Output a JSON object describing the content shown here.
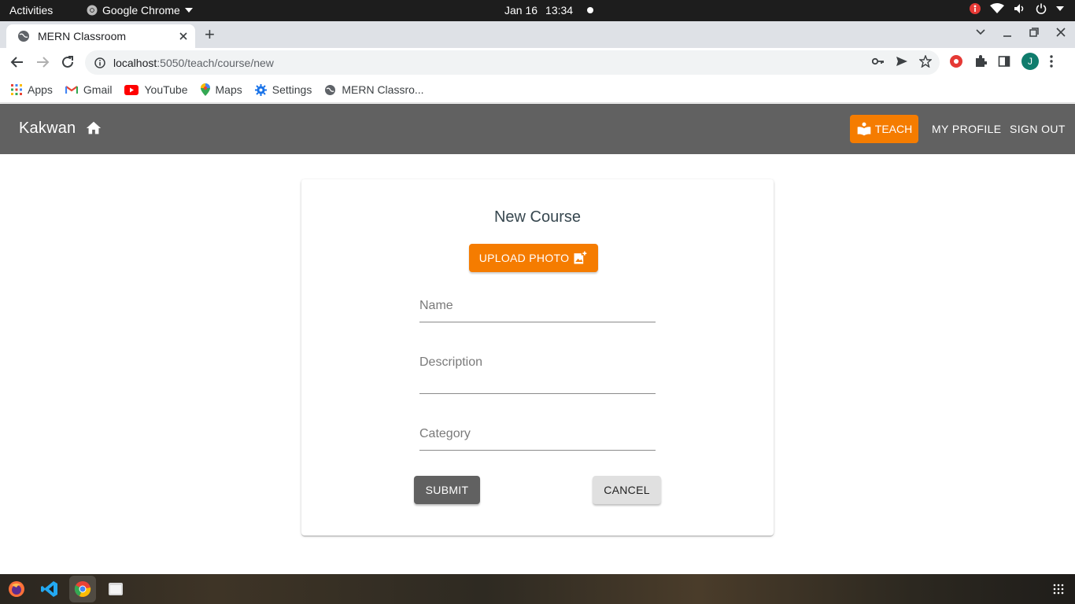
{
  "system": {
    "activities": "Activities",
    "app_name": "Google Chrome",
    "date": "Jan 16",
    "time": "13:34"
  },
  "browser": {
    "tab_title": "MERN Classroom",
    "url_host": "localhost",
    "url_path": ":5050/teach/course/new",
    "profile_initial": "J"
  },
  "bookmarks": [
    {
      "label": "Apps",
      "icon": "apps-grid-icon"
    },
    {
      "label": "Gmail",
      "icon": "gmail-icon"
    },
    {
      "label": "YouTube",
      "icon": "youtube-icon"
    },
    {
      "label": "Maps",
      "icon": "maps-pin-icon"
    },
    {
      "label": "Settings",
      "icon": "gear-icon"
    },
    {
      "label": "MERN Classro...",
      "icon": "globe-icon"
    }
  ],
  "appbar": {
    "brand": "Kakwan",
    "teach_label": "TEACH",
    "profile_label": "MY PROFILE",
    "signout_label": "SIGN OUT",
    "accent": "#f57c00",
    "bar_color": "#616161"
  },
  "form": {
    "title": "New Course",
    "upload_label": "UPLOAD PHOTO",
    "name_placeholder": "Name",
    "description_placeholder": "Description",
    "category_placeholder": "Category",
    "submit_label": "SUBMIT",
    "cancel_label": "CANCEL"
  }
}
